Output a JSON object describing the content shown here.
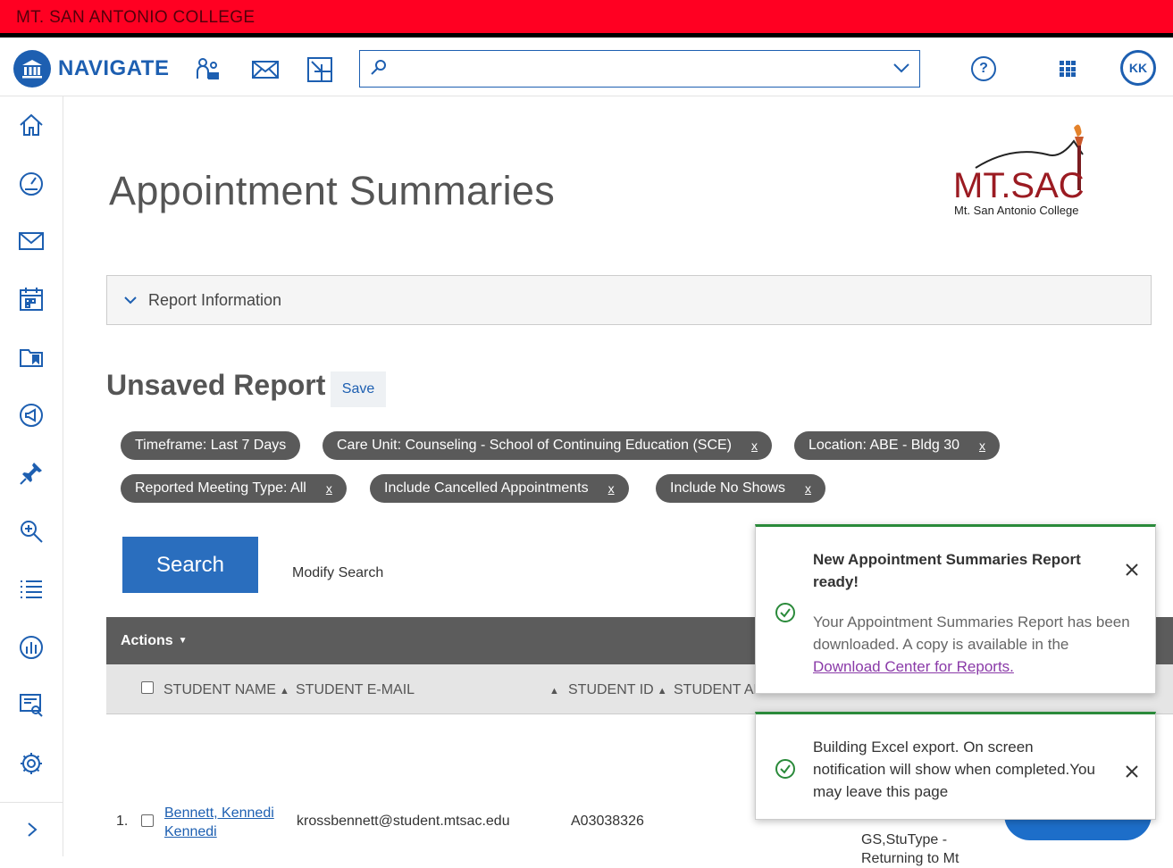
{
  "topbar": {
    "college": "MT. SAN ANTONIO COLLEGE"
  },
  "navbar": {
    "brand": "NAVIGATE",
    "search_placeholder": "",
    "help": "?",
    "avatar": "KK"
  },
  "page": {
    "title": "Appointment Summaries",
    "logo_main": "MT.SAC",
    "logo_sub": "Mt. San Antonio College",
    "report_info": "Report Information",
    "unsaved": "Unsaved Report",
    "save": "Save"
  },
  "filters": [
    {
      "label": "Timeframe: Last 7 Days",
      "remove": ""
    },
    {
      "label": "Care Unit: Counseling - School of Continuing Education (SCE)",
      "remove": "x"
    },
    {
      "label": "Location: ABE - Bldg 30",
      "remove": "x"
    },
    {
      "label": "Reported Meeting Type: All",
      "remove": "x"
    },
    {
      "label": "Include Cancelled Appointments",
      "remove": "x"
    },
    {
      "label": "Include No Shows",
      "remove": "x"
    }
  ],
  "search": {
    "button": "Search",
    "modify": "Modify Search"
  },
  "table": {
    "actions": "Actions",
    "columns": [
      "STUDENT NAME",
      "STUDENT E-MAIL",
      "STUDENT ID",
      "STUDENT AL"
    ],
    "rows": [
      {
        "index": "1.",
        "name_line1": "Bennett, Kennedi",
        "name_line2": "Kennedi",
        "email": "krossbennett@student.mtsac.edu",
        "id": "A03038326",
        "extra_line1": "GS,StuType -",
        "extra_line2": "Returning to Mt"
      }
    ]
  },
  "toasts": {
    "report": {
      "title": "New Appointment Summaries Report ready!",
      "body": "Your Appointment Summaries Report has been downloaded. A copy is available in the",
      "link": "Download Center for Reports."
    },
    "export": {
      "message": "Building Excel export. On screen notification will show when completed.You may leave this page"
    }
  },
  "colors": {
    "brand": "#1d5fb1",
    "topbar": "#ff0022",
    "success": "#2a8a3a"
  }
}
